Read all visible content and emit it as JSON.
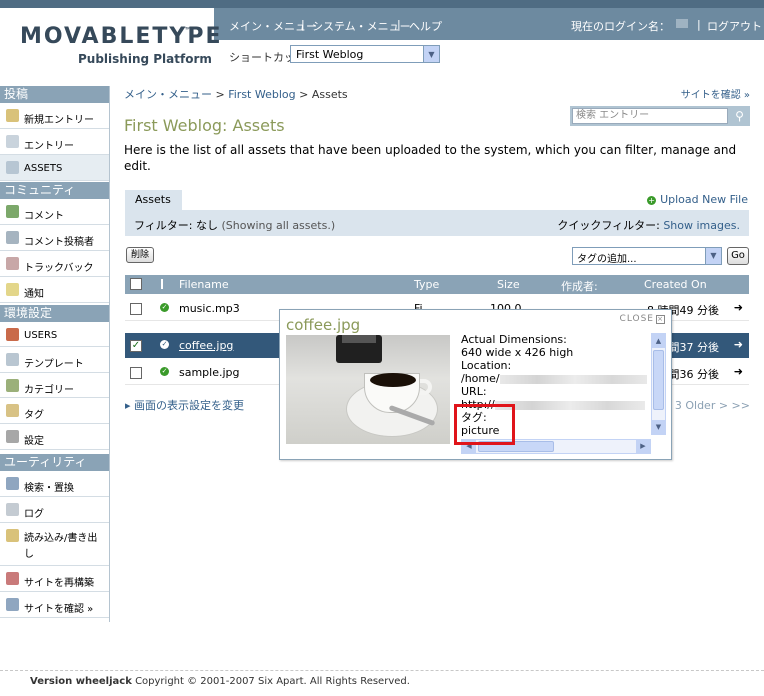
{
  "header": {
    "logo_word": "MOVABLETYPE",
    "logo_tm": "™",
    "logo_sub": "Publishing Platform",
    "nav": {
      "main_menu": "メイン・メニュー",
      "system_menu": "システム・メニュー",
      "help": "ヘルプ",
      "sep": "|",
      "login_label": "現在のログイン名：",
      "logout": "ログアウト"
    },
    "shortcut_label": "ショートカット:",
    "blog_select_value": "First Weblog"
  },
  "sidebar": {
    "sections": [
      {
        "title": "投稿",
        "items": [
          "新規エントリー",
          "エントリー",
          "ASSETS"
        ]
      },
      {
        "title": "コミュニティ",
        "items": [
          "コメント",
          "コメント投稿者",
          "トラックバック",
          "通知"
        ]
      },
      {
        "title": "環境設定",
        "items": [
          "USERS",
          "テンプレート",
          "カテゴリー",
          "タグ",
          "設定"
        ]
      },
      {
        "title": "ユーティリティ",
        "items": [
          "検索・置換",
          "ログ",
          "読み込み/書き出し",
          "サイトを再構築",
          "サイトを確認 »"
        ]
      }
    ]
  },
  "breadcrumb": {
    "main": "メイン・メニュー",
    "blog": "First Weblog",
    "current": "Assets",
    "sep": ">"
  },
  "site_view_link": "サイトを確認 »",
  "search": {
    "placeholder": "検索 エントリー"
  },
  "page": {
    "title": "First Weblog: Assets",
    "description": "Here is the list of all assets that have been uploaded to the system, which you can filter, manage and edit."
  },
  "tabs": {
    "assets": "Assets"
  },
  "upload_link": "Upload New File",
  "filter": {
    "label": "フィルター: なし",
    "showing": "(Showing all assets.)",
    "quick_label": "クイックフィルター:",
    "quick_link": "Show images."
  },
  "actions": {
    "delete": "削除",
    "tag_select": "タグの追加...",
    "go": "Go"
  },
  "table": {
    "columns": [
      "Filename",
      "Type",
      "Size",
      "作成者:",
      "Created On"
    ],
    "rows": [
      {
        "filename": "music.mp3",
        "type": "Fi...",
        "size": "100.0...",
        "author": "...",
        "created": "8 時間49 分後",
        "selected": false
      },
      {
        "filename": "coffee.jpg",
        "type": "",
        "size": "",
        "author": "",
        "created": "8 時間37 分後",
        "selected": true
      },
      {
        "filename": "sample.jpg",
        "type": "",
        "size": "",
        "author": "",
        "created": "8 時間36 分後",
        "selected": false
      }
    ]
  },
  "display_settings": "画面の表示設定を変更",
  "pager": "3 Older > >>",
  "popup": {
    "title": "coffee.jpg",
    "close": "CLOSE",
    "meta": {
      "dimensions_label": "Actual Dimensions:",
      "dimensions_value": "640 wide x 426 high",
      "location_label": "Location:",
      "location_value": "/home/",
      "url_label": "URL:",
      "url_value": "http://",
      "tags_label": "タグ:",
      "tags_value": "picture"
    }
  },
  "footer": {
    "version": "Version wheeljack",
    "copyright": "Copyright © 2001-2007 Six Apart. All Rights Reserved."
  },
  "colors": {
    "brand_dark": "#4f6c83",
    "sidebar_head": "#8aa3b6",
    "title_olive": "#8b9a5a",
    "link": "#335f8a",
    "selected_row": "#33587a",
    "highlight_red": "#e0141a"
  }
}
